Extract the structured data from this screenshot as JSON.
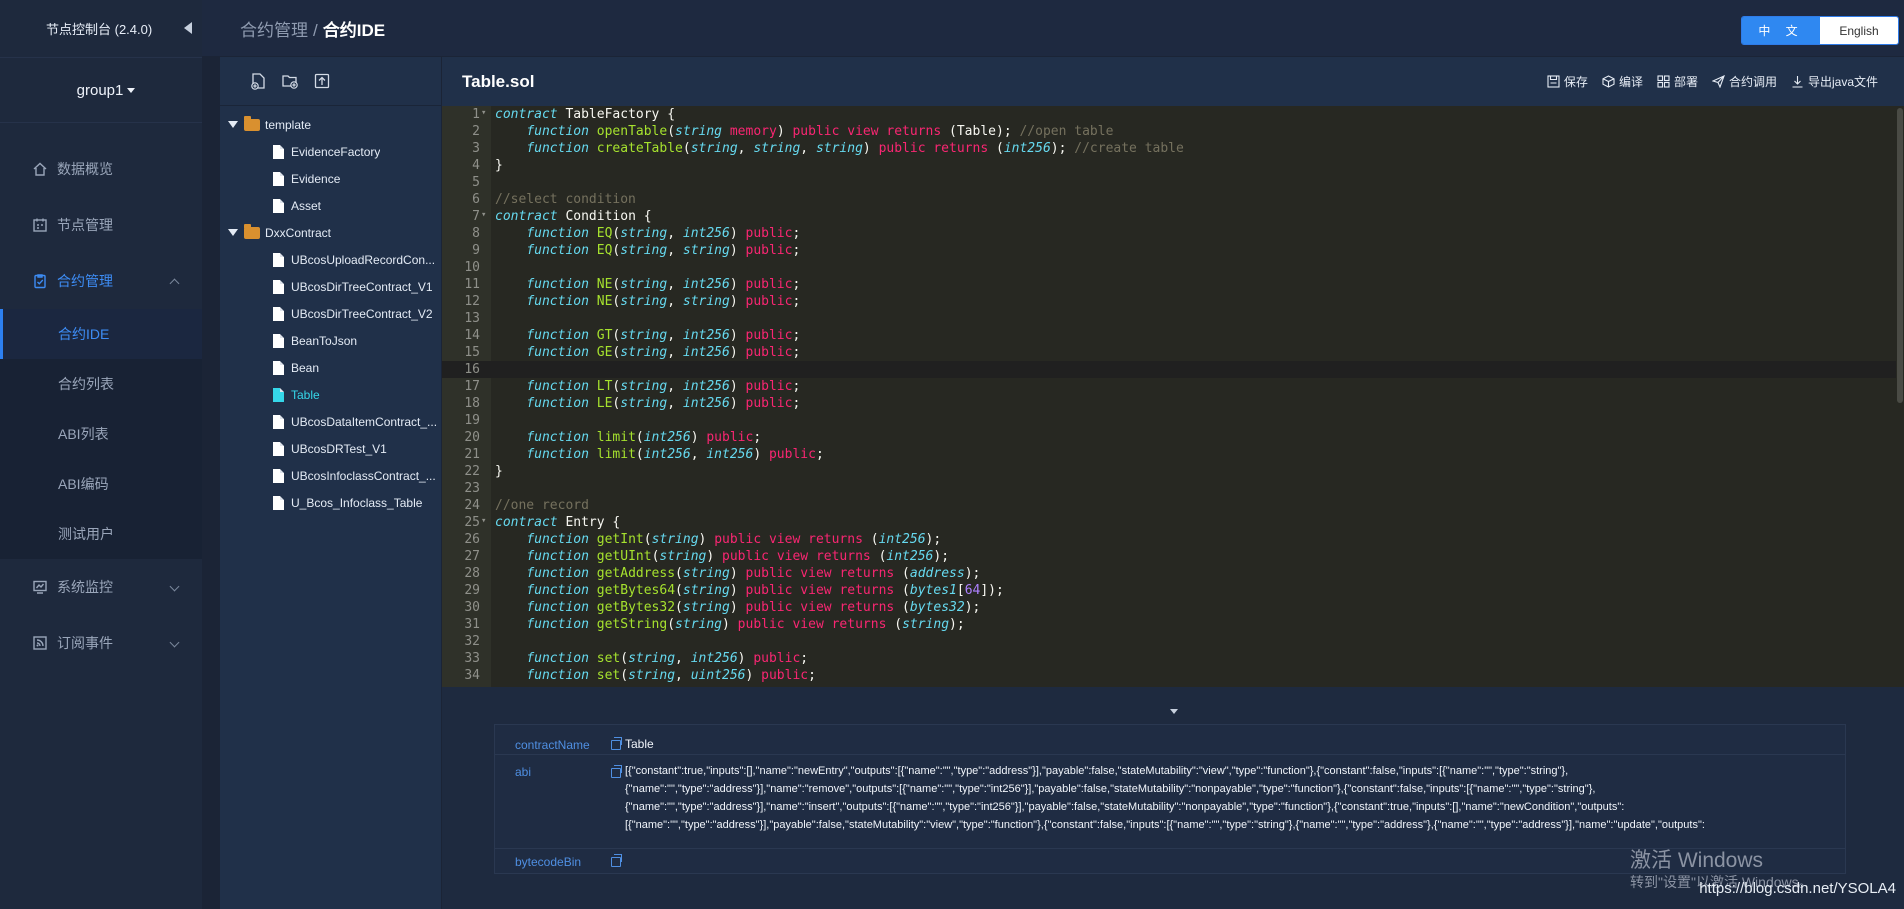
{
  "app": {
    "title": "节点控制台 (2.4.0)",
    "group": "group1"
  },
  "menu": {
    "overview": "数据概览",
    "nodes": "节点管理",
    "contracts": "合约管理",
    "sub": [
      "合约IDE",
      "合约列表",
      "ABI列表",
      "ABI编码",
      "测试用户"
    ],
    "monitor": "系统监控",
    "events": "订阅事件"
  },
  "breadcrumb": {
    "parent": "合约管理",
    "sep": "/",
    "current": "合约IDE"
  },
  "lang": {
    "zh": "中 文",
    "en": "English"
  },
  "tree": {
    "folders": [
      {
        "name": "template",
        "files": [
          "EvidenceFactory",
          "Evidence",
          "Asset"
        ]
      },
      {
        "name": "DxxContract",
        "files": [
          "UBcosUploadRecordCon...",
          "UBcosDirTreeContract_V1",
          "UBcosDirTreeContract_V2",
          "BeanToJson",
          "Bean",
          "Table",
          "UBcosDataItemContract_...",
          "UBcosDRTest_V1",
          "UBcosInfoclassContract_...",
          "U_Bcos_Infoclass_Table"
        ]
      }
    ],
    "selected": "Table"
  },
  "editor": {
    "file": "Table.sol",
    "actions": {
      "save": "保存",
      "compile": "编译",
      "deploy": "部署",
      "call": "合约调用",
      "export": "导出java文件"
    },
    "lines": [
      "contract TableFactory {",
      "    function openTable(string memory) public view returns (Table); //open table",
      "    function createTable(string, string, string) public returns (int256); //create table",
      "}",
      "",
      "//select condition",
      "contract Condition {",
      "    function EQ(string, int256) public;",
      "    function EQ(string, string) public;",
      "",
      "    function NE(string, int256) public;",
      "    function NE(string, string) public;",
      "",
      "    function GT(string, int256) public;",
      "    function GE(string, int256) public;",
      "",
      "    function LT(string, int256) public;",
      "    function LE(string, int256) public;",
      "",
      "    function limit(int256) public;",
      "    function limit(int256, int256) public;",
      "}",
      "",
      "//one record",
      "contract Entry {",
      "    function getInt(string) public view returns (int256);",
      "    function getUInt(string) public view returns (int256);",
      "    function getAddress(string) public view returns (address);",
      "    function getBytes64(string) public view returns (bytes1[64]);",
      "    function getBytes32(string) public view returns (bytes32);",
      "    function getString(string) public view returns (string);",
      "",
      "    function set(string, int256) public;",
      "    function set(string, uint256) public;"
    ]
  },
  "output": {
    "contractName_label": "contractName",
    "contractName": "Table",
    "abi_label": "abi",
    "abi": [
      "[{\"constant\":true,\"inputs\":[],\"name\":\"newEntry\",\"outputs\":[{\"name\":\"\",\"type\":\"address\"}],\"payable\":false,\"stateMutability\":\"view\",\"type\":\"function\"},{\"constant\":false,\"inputs\":[{\"name\":\"\",\"type\":\"string\"},",
      "{\"name\":\"\",\"type\":\"address\"}],\"name\":\"remove\",\"outputs\":[{\"name\":\"\",\"type\":\"int256\"}],\"payable\":false,\"stateMutability\":\"nonpayable\",\"type\":\"function\"},{\"constant\":false,\"inputs\":[{\"name\":\"\",\"type\":\"string\"},",
      "{\"name\":\"\",\"type\":\"address\"}],\"name\":\"insert\",\"outputs\":[{\"name\":\"\",\"type\":\"int256\"}],\"payable\":false,\"stateMutability\":\"nonpayable\",\"type\":\"function\"},{\"constant\":true,\"inputs\":[],\"name\":\"newCondition\",\"outputs\":",
      "[{\"name\":\"\",\"type\":\"address\"}],\"payable\":false,\"stateMutability\":\"view\",\"type\":\"function\"},{\"constant\":false,\"inputs\":[{\"name\":\"\",\"type\":\"string\"},{\"name\":\"\",\"type\":\"address\"},{\"name\":\"\",\"type\":\"address\"}],\"name\":\"update\",\"outputs\":"
    ],
    "bytecode_label": "bytecodeBin"
  },
  "watermark": {
    "line1": "激活 Windows",
    "line2": "转到\"设置\"以激活 Windows。",
    "csdn": "https://blog.csdn.net/YSOLA4"
  },
  "colors": {
    "accent": "#2f88f1",
    "sidebar": "#1e293d",
    "editor_bg": "#272822",
    "selected_file": "#35d7e9"
  }
}
